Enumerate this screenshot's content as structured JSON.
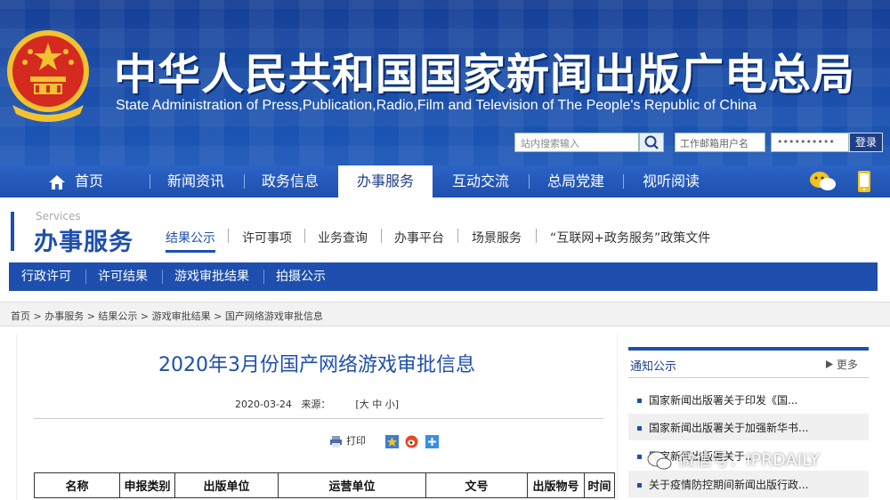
{
  "header": {
    "title_cn": "中华人民共和国国家新闻出版广电总局",
    "title_en": "State Administration of Press,Publication,Radio,Film and Television of The People's Republic of China",
    "search_placeholder": "站内搜索输入",
    "user_placeholder": "工作邮箱用户名",
    "password_mask": "••••••••••",
    "login_label": "登录"
  },
  "nav": {
    "items": [
      "首页",
      "新闻资讯",
      "政务信息",
      "办事服务",
      "互动交流",
      "总局党建",
      "视听阅读"
    ],
    "active": "办事服务"
  },
  "section": {
    "en": "Services",
    "cn": "办事服务",
    "tabs": [
      "结果公示",
      "许可事项",
      "业务查询",
      "办事平台",
      "场景服务",
      "“互联网+政务服务”政策文件"
    ],
    "active_tab": "结果公示"
  },
  "subbar": {
    "items": [
      "行政许可",
      "许可结果",
      "游戏审批结果",
      "拍摄公示"
    ]
  },
  "breadcrumb": {
    "text": "首页 > 办事服务 > 结果公示 > 游戏审批结果 > 国产网络游戏审批信息"
  },
  "article": {
    "title": "2020年3月份国产网络游戏审批信息",
    "date": "2020-03-24",
    "source_label": "来源：",
    "font_size": "[大 中 小]",
    "print_label": "打印",
    "table_headers": [
      "名称",
      "申报类别",
      "出版单位",
      "运营单位",
      "文号",
      "出版物号",
      "时间"
    ]
  },
  "sidebar": {
    "title": "通知公示",
    "more": "更多",
    "items": [
      "国家新闻出版署关于印发《国...",
      "国家新闻出版署关于加强新华书...",
      "国家新闻出版署关于...",
      "关于疫情防控期间新闻出版行政..."
    ]
  },
  "watermark": {
    "text": "微信号：IPRDAILY"
  },
  "colors": {
    "brand_blue": "#1e4fae",
    "banner_blue": "#163f95",
    "emblem_red": "#d42a1f",
    "emblem_gold": "#f2c230"
  }
}
